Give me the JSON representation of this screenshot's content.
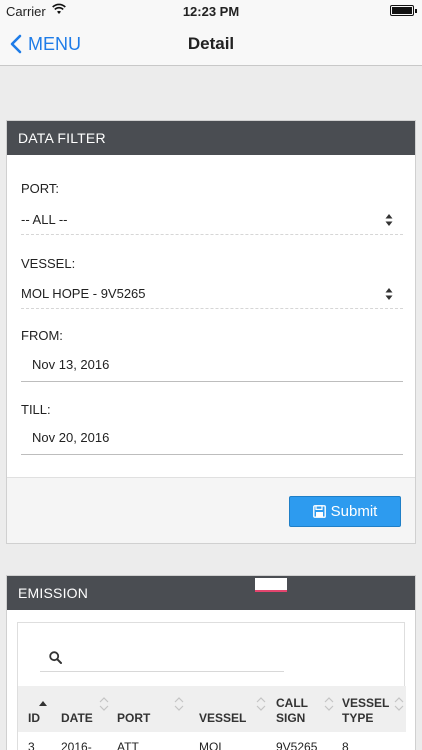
{
  "status_bar": {
    "carrier": "Carrier",
    "time": "12:23 PM"
  },
  "nav": {
    "back_label": "MENU",
    "title": "Detail"
  },
  "filter": {
    "title": "DATA FILTER",
    "port": {
      "label": "PORT:",
      "value": "-- ALL --"
    },
    "vessel": {
      "label": "VESSEL:",
      "value": "MOL HOPE - 9V5265"
    },
    "from": {
      "label": "FROM:",
      "value": "Nov 13, 2016"
    },
    "till": {
      "label": "TILL:",
      "value": "Nov 20, 2016"
    },
    "submit_label": "Submit"
  },
  "emission": {
    "title": "EMISSION",
    "columns": [
      "ID",
      "DATE",
      "PORT",
      "VESSEL",
      "CALL SIGN",
      "VESSEL TYPE"
    ],
    "rows": [
      [
        "3",
        "2016-",
        "ATT",
        "MOL",
        "9V5265",
        "8"
      ]
    ]
  },
  "colors": {
    "accent": "#1e7ce8",
    "panel_header": "#4a4d52",
    "button": "#2d9bef"
  },
  "icons": {
    "back": "chevron-left-icon",
    "wifi": "wifi-icon",
    "battery": "battery-icon",
    "submit": "floppy-disk-icon",
    "search": "search-icon",
    "sort": "sort-icon"
  }
}
